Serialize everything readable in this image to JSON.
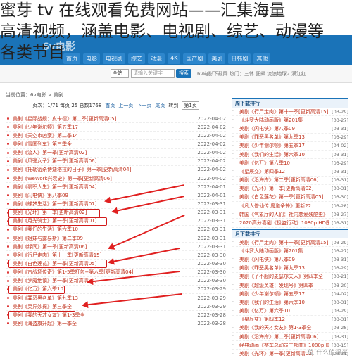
{
  "overlay": {
    "line1": "蜜芽 tv 在线观看免费网站——汇集海量",
    "line2": "高清视频，涵盖电影、电视剧、综艺、动漫等",
    "line3": "各类节目"
  },
  "header": {
    "logo": "6v电影",
    "nav": [
      "首页",
      "电影",
      "电视剧",
      "综艺",
      "动漫",
      "4K",
      "国产剧",
      "美剧",
      "日韩剧",
      "其他"
    ]
  },
  "search": {
    "scope": "全站",
    "placeholder": "请输入关键字",
    "button": "搜索",
    "hot": "6v电影下载网 热门：三体 狂飙 流浪地球2 满江红"
  },
  "breadcrumb": "当前位置：6v电影 > 美剧",
  "pager": {
    "info": "页次：1/71 每页 25 总数1768",
    "first": "首页",
    "prev": "上一页",
    "next": "下一页",
    "last": "尾页",
    "jump_label": "转到",
    "jump_value": "第1页"
  },
  "rows": [
    {
      "title": "美剧《星际战舰：皮卡德》第二季[更新高清05]",
      "date": "2022-04-02"
    },
    {
      "title": "美剧《少年谢尔顿》第五季17",
      "date": "2022-04-02"
    },
    {
      "title": "美剧《天空市凶案》第二季14",
      "date": "2022-04-02"
    },
    {
      "title": "美剧《雪国列车》第三季全",
      "date": "2022-04-02"
    },
    {
      "title": "美剧《流人》第一季[更新高清02]",
      "date": "2022-04-02"
    },
    {
      "title": "美剧《风骚女子》第一季[更新高清06]",
      "date": "2022-04-02"
    },
    {
      "title": "美剧《托勒密杀博迪塔拉的日子》第一季[更新高清04]",
      "date": "2022-04-02"
    },
    {
      "title": "美剧《WeWork兴衰史》第一季[更新高清06]",
      "date": "2022-04-02"
    },
    {
      "title": "美剧《裹职人生》第一季[更新高清04]",
      "date": "2022-04-01"
    },
    {
      "title": "美剧《闪电侠》第八季09",
      "date": "2022-04-01"
    },
    {
      "title": "美剧《蝶梦生活》第一季[更新高清07]",
      "date": "2022-03-31"
    },
    {
      "title": "美剧《光环》第一季[更新高清02]",
      "date": "2022-03-31"
    },
    {
      "title": "美剧《月光骑士》第一季[更新高清01]",
      "date": "2022-03-31"
    },
    {
      "title": "美剧《我们的生活》第六季10",
      "date": "2022-03-31"
    },
    {
      "title": "美剧《姐妹与露易斯》第二季09",
      "date": "2022-03-31"
    },
    {
      "title": "美剧《绿同》第一季[更新高清06]",
      "date": "2022-03-31"
    },
    {
      "title": "美剧《行尸走肉》第十一季[更新高清15]",
      "date": "2022-03-30"
    },
    {
      "title": "美剧《白色莲花》第一季[更新高清05]",
      "date": "2022-03-30"
    },
    {
      "title": "美剧《古战场传奇》第1-5季打包+第六季[更新高清04]",
      "date": "2022-03-30"
    },
    {
      "title": "美剧《梦魇绝镇》第一季[更新高清06]",
      "date": "2022-03-30"
    },
    {
      "title": "美剧《亿万》第六季10",
      "date": "2022-03-29"
    },
    {
      "title": "美剧《罪恶黑名单》第九季13",
      "date": "2022-03-29"
    },
    {
      "title": "美剧《灵异妙探》第三季全",
      "date": "2022-03-29"
    },
    {
      "title": "美剧《我的天才女友》第1-3季全",
      "date": "2022-03-28"
    },
    {
      "title": "美剧《海盗旗升起》第一季全",
      "date": "2022-03-28"
    }
  ],
  "weekly": {
    "title": "周下载排行",
    "items": [
      {
        "t": "美剧《行尸走肉》第十一季[更新高清15]",
        "d": "[03-29]"
      },
      {
        "t": "《斗罗大陆动画版》第201集",
        "d": "[03-27]"
      },
      {
        "t": "美剧《闪电侠》第八季09",
        "d": "[03-31]"
      },
      {
        "t": "美剧《罪恶黑名单》第九季13",
        "d": "[03-29]"
      },
      {
        "t": "美剧《少年谢尔顿》第五季17",
        "d": "[04-02]"
      },
      {
        "t": "美剧《我们的生活》第六季10",
        "d": "[03-31]"
      },
      {
        "t": "美剧《亿万》第六季10",
        "d": "[03-29]"
      },
      {
        "t": "《星辰变》第四季12",
        "d": "[03-31]"
      },
      {
        "t": "美剧《沿海岸》第二季[更新高清06]",
        "d": "[03-31]"
      },
      {
        "t": "美剧《光环》第一季[更新高清02]",
        "d": "[03-31]"
      },
      {
        "t": "美剧《白色莲花》第一季[更新高清05]",
        "d": "[03-30]"
      },
      {
        "t": "《凡人修仙传 魔道争锋》更新22",
        "d": "[03-28]"
      },
      {
        "t": "韩国《气象厅的人们：社内恋爱残酷史》",
        "d": "[03-27]"
      },
      {
        "t": "2020高分喜剧《极盗行动》1080p.HD国语",
        "d": "[03-31]"
      },
      {
        "t": "美剧《超能英雄》第一季全",
        "d": "[03-26]"
      }
    ]
  },
  "monthly": {
    "title": "月下载排行",
    "items": [
      {
        "t": "美剧《行尸走肉》第十一季[更新高清15]",
        "d": "[03-29]"
      },
      {
        "t": "《斗罗大陆动画版》第201集",
        "d": "[03-27]"
      },
      {
        "t": "美剧《闪电侠》第八季09",
        "d": "[03-31]"
      },
      {
        "t": "美剧《罪恶黑名单》第九季13",
        "d": "[03-29]"
      },
      {
        "t": "美剧《了不起的麦瑟尔夫人》第四季全",
        "d": "[03-21]"
      },
      {
        "t": "美剧《超级英雄：发现号》第四季",
        "d": "[03-20]"
      },
      {
        "t": "美剧《少年谢尔顿》第五季17",
        "d": "[04-02]"
      },
      {
        "t": "美剧《我们的生活》第六季10",
        "d": "[03-31]"
      },
      {
        "t": "美剧《亿万》第六季10",
        "d": "[03-29]"
      },
      {
        "t": "《星辰变》第四季12",
        "d": "[03-31]"
      },
      {
        "t": "美剧《我的天才女友》第1-3季全",
        "d": "[03-28]"
      },
      {
        "t": "美剧《沿海岸》第二季[更新高清06]",
        "d": "[03-31]"
      },
      {
        "t": "经典动画《赛车总动员三部曲》1080p.国",
        "d": "[03-15]"
      },
      {
        "t": "美剧《光环》第一季[更新高清02]",
        "d": "[03-31]"
      },
      {
        "t": "美剧《鹏日传奇》第七季13",
        "d": "[03-29]"
      }
    ]
  },
  "watermark": "值 什么值得买",
  "colors": {
    "accent": "#1a73b8",
    "title": "#c0301b",
    "highlight": "#d21b1b"
  }
}
